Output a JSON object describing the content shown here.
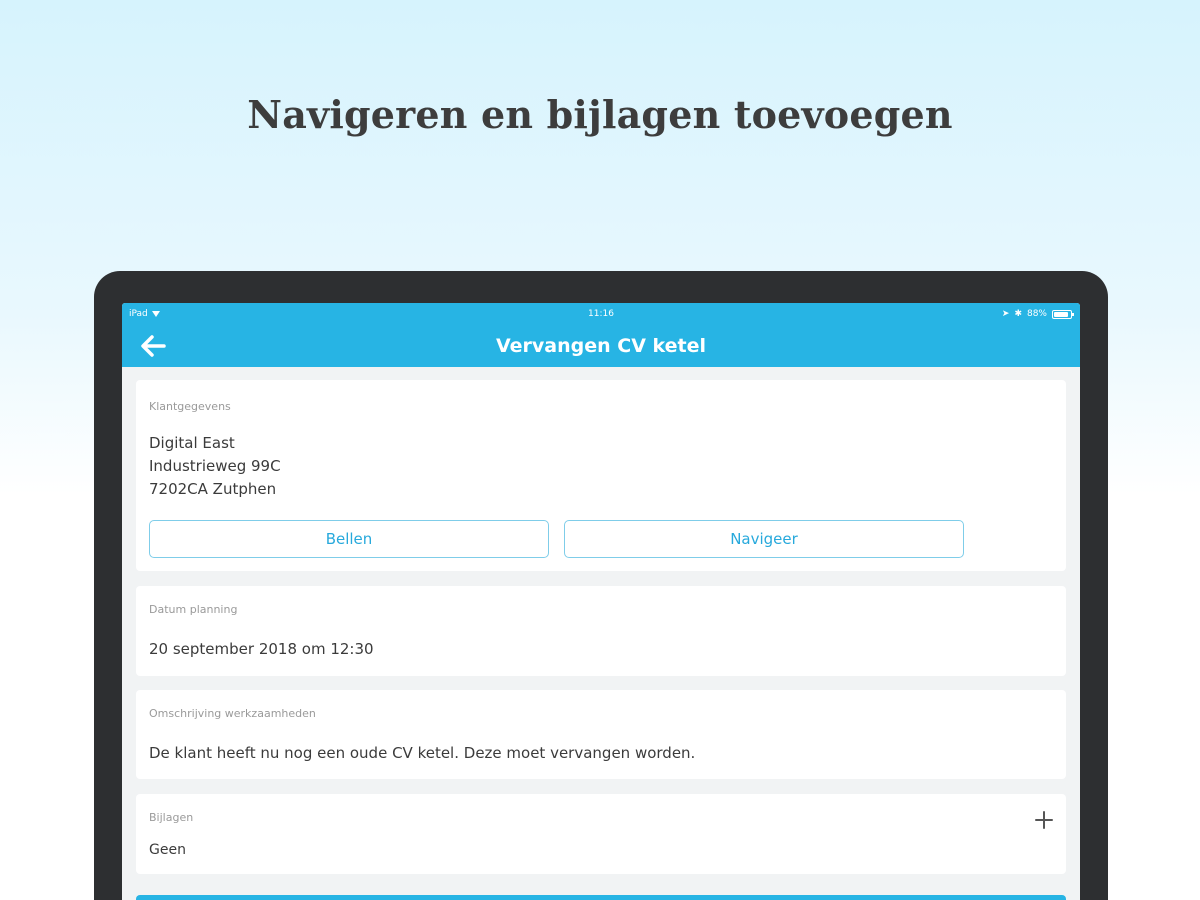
{
  "headline": "Navigeren en bijlagen toevoegen",
  "status_bar": {
    "device": "iPad",
    "time": "11:16",
    "battery": "88%"
  },
  "nav": {
    "title": "Vervangen CV ketel"
  },
  "customer": {
    "label": "Klantgegevens",
    "name": "Digital East",
    "street": "Industrieweg 99C",
    "city": "7202CA Zutphen",
    "call_button": "Bellen",
    "navigate_button": "Navigeer"
  },
  "planning": {
    "label": "Datum planning",
    "value": "20 september 2018 om 12:30"
  },
  "description": {
    "label": "Omschrijving werkzaamheden",
    "value": "De klant heeft nu nog een oude CV ketel. Deze moet vervangen worden."
  },
  "attachments": {
    "label": "Bijlagen",
    "value": "Geen"
  },
  "colors": {
    "accent": "#27b4e4",
    "device": "#2d2f31",
    "button_text": "#27a9dc"
  }
}
